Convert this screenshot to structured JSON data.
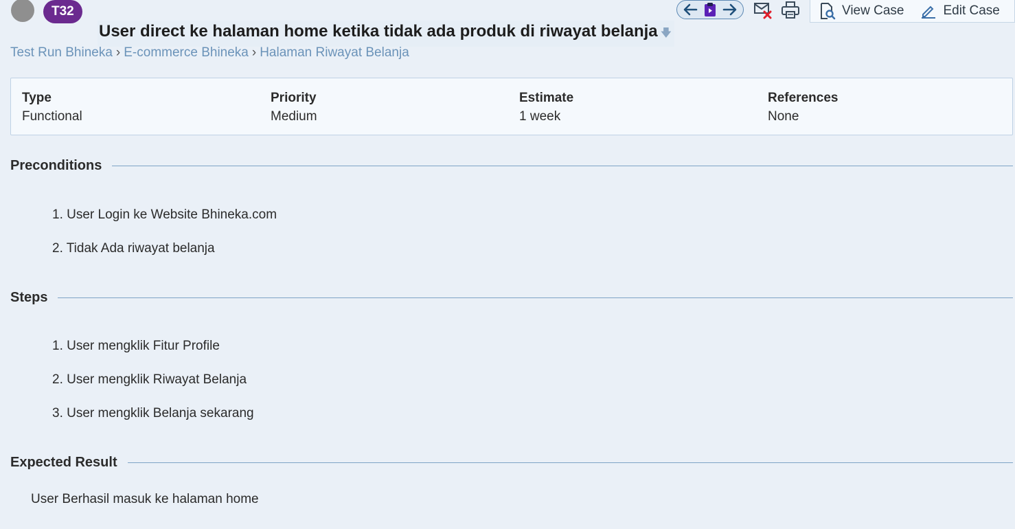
{
  "header": {
    "case_id": "T32",
    "title": "User direct ke halaman home ketika tidak ada produk di riwayat belanja",
    "view_case_label": "View Case",
    "edit_case_label": "Edit Case"
  },
  "breadcrumb": [
    "Test Run Bhineka",
    "E-commerce Bhineka",
    "Halaman Riwayat Belanja"
  ],
  "info": {
    "type_label": "Type",
    "type_value": "Functional",
    "priority_label": "Priority",
    "priority_value": "Medium",
    "estimate_label": "Estimate",
    "estimate_value": "1 week",
    "references_label": "References",
    "references_value": "None"
  },
  "preconditions": {
    "label": "Preconditions",
    "items": [
      "1. User Login ke Website Bhineka.com",
      "2. Tidak Ada riwayat belanja"
    ]
  },
  "steps": {
    "label": "Steps",
    "items": [
      "1. User mengklik Fitur Profile",
      "2. User mengklik Riwayat Belanja",
      "3. User mengklik Belanja sekarang"
    ]
  },
  "expected": {
    "label": "Expected Result",
    "text": "User Berhasil masuk ke halaman home"
  },
  "colors": {
    "background": "#eaf0f7",
    "case_badge": "#6b2a8f",
    "link": "#6b93b9",
    "rule": "#7ea3c6"
  },
  "icons": [
    "arrow-left-icon",
    "clipboard-icon",
    "arrow-right-icon",
    "mail-x-icon",
    "printer-icon",
    "document-search-icon",
    "pencil-icon",
    "arrow-down-icon"
  ]
}
